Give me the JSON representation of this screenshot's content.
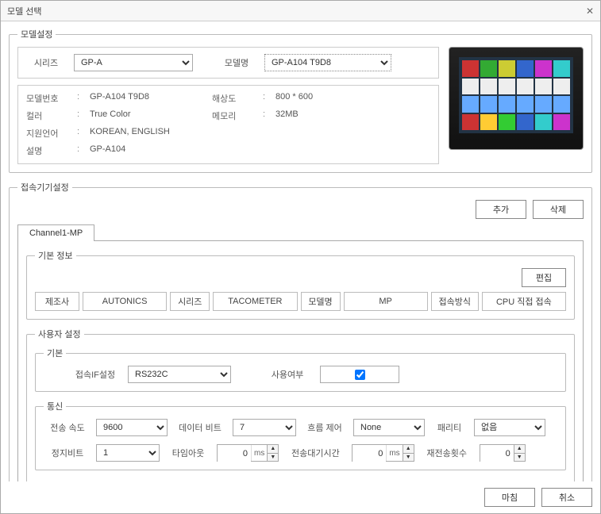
{
  "window": {
    "title": "모델 선택"
  },
  "modelSettings": {
    "legend": "모델설정",
    "seriesLabel": "시리즈",
    "seriesValue": "GP-A",
    "modelNameLabel": "모델명",
    "modelNameValue": "GP-A104 T9D8",
    "info": {
      "modelNoLabel": "모델번호",
      "modelNo": "GP-A104 T9D8",
      "resolutionLabel": "해상도",
      "resolution": "800 * 600",
      "colorLabel": "컬러",
      "color": "True Color",
      "memoryLabel": "메모리",
      "memory": "32MB",
      "langLabel": "지원언어",
      "lang": "KOREAN, ENGLISH",
      "descLabel": "설명",
      "desc": "GP-A104"
    }
  },
  "connSettings": {
    "legend": "접속기기설정",
    "addBtn": "추가",
    "deleteBtn": "삭제",
    "tab1": "Channel1-MP",
    "basicInfo": {
      "legend": "기본 정보",
      "editBtn": "편집",
      "makerLabel": "제조사",
      "maker": "AUTONICS",
      "seriesLabel": "시리즈",
      "series": "TACOMETER",
      "modelLabel": "모델명",
      "model": "MP",
      "connTypeLabel": "접속방식",
      "connType": "CPU 직접 접속"
    },
    "userSettings": {
      "legend": "사용자 설정",
      "basic": {
        "legend": "기본",
        "ifLabel": "접속IF설정",
        "ifValue": "RS232C",
        "useLabel": "사용여부"
      },
      "comm": {
        "legend": "통신",
        "baudLabel": "전송 속도",
        "baud": "9600",
        "dataBitLabel": "데이터 비트",
        "dataBit": "7",
        "flowLabel": "흐름 제어",
        "flow": "None",
        "parityLabel": "패리티",
        "parity": "없음",
        "stopBitLabel": "정지비트",
        "stopBit": "1",
        "timeoutLabel": "타임아웃",
        "timeout": "0",
        "timeoutUnit": "ms",
        "waitLabel": "전송대기시간",
        "wait": "0",
        "waitUnit": "ms",
        "retryLabel": "재전송횟수",
        "retry": "0"
      }
    }
  },
  "footer": {
    "finish": "마침",
    "cancel": "취소"
  }
}
